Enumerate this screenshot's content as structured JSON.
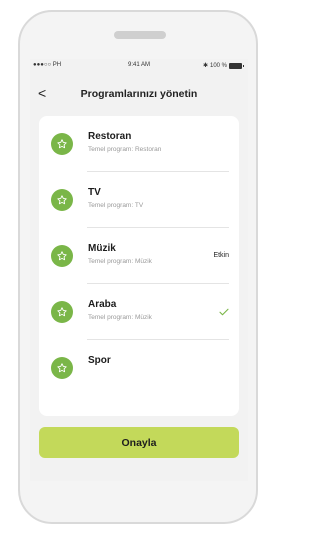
{
  "status_bar": {
    "carrier": "●●●○○ PH",
    "time": "9:41 AM",
    "battery": "100 %"
  },
  "header": {
    "back_label": "<",
    "title": "Programlarınızı yönetin"
  },
  "programs": [
    {
      "name": "Restoran",
      "subtitle": "Temel program: Restoran",
      "status": "",
      "checked": false,
      "icon": "star-icon"
    },
    {
      "name": "TV",
      "subtitle": "Temel program: TV",
      "status": "",
      "checked": false,
      "icon": "star-icon"
    },
    {
      "name": "Müzik",
      "subtitle": "Temel program: Müzik",
      "status": "Etkin",
      "checked": false,
      "icon": "star-icon"
    },
    {
      "name": "Araba",
      "subtitle": "Temel program: Müzik",
      "status": "",
      "checked": true,
      "icon": "star-icon"
    },
    {
      "name": "Spor",
      "subtitle": "",
      "status": "",
      "checked": false,
      "icon": "star-icon"
    }
  ],
  "footer": {
    "confirm_label": "Onayla"
  },
  "colors": {
    "accent_green": "#7ab648",
    "button_lime": "#c3d95a",
    "check_green": "#7ab648"
  }
}
